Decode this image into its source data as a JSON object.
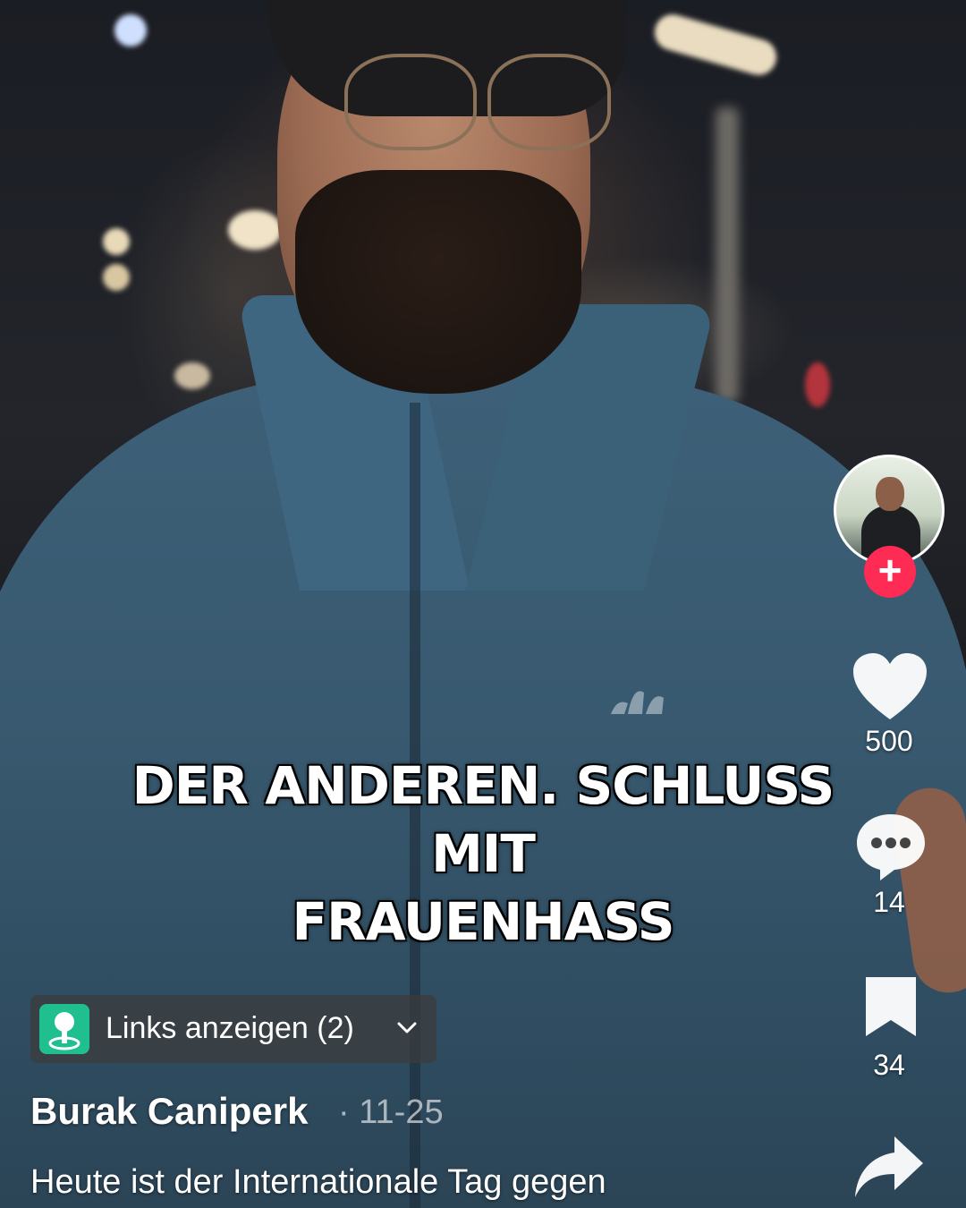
{
  "video": {
    "caption_line1": "DER ANDEREN. SCHLUSS MIT",
    "caption_line2": "FRAUENHASS"
  },
  "rail": {
    "avatar_icon": "creator-avatar",
    "follow_icon": "plus-icon",
    "like_icon": "heart-icon",
    "like_count": "500",
    "comment_icon": "comment-bubble-icon",
    "comment_count": "14",
    "bookmark_icon": "bookmark-icon",
    "bookmark_count": "34",
    "share_icon": "share-arrow-icon"
  },
  "info": {
    "links_label": "Links anzeigen (2)",
    "author": "Burak Caniperk",
    "date": "· 11-25",
    "description": "Heute ist der Internationale Tag gegen"
  },
  "colors": {
    "follow": "#fe2c55",
    "links_icon": "#1fbf8f"
  }
}
